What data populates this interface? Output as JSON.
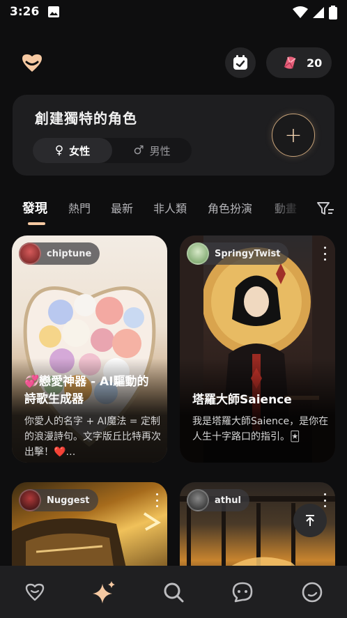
{
  "status_bar": {
    "time": "3:26"
  },
  "header": {
    "gem_count": "20"
  },
  "create_card": {
    "title": "創建獨特的角色",
    "female_label": "女性",
    "male_label": "男性",
    "female_symbol": "♀",
    "male_symbol": "♂",
    "plus_symbol": "+"
  },
  "tabs": [
    {
      "label": "發現",
      "active": true
    },
    {
      "label": "熱門"
    },
    {
      "label": "最新"
    },
    {
      "label": "非人類"
    },
    {
      "label": "角色扮演"
    },
    {
      "label": "動畫"
    }
  ],
  "cards": [
    {
      "author": "chiptune",
      "title": "💞戀愛神器 - AI驅動的詩歌生成器",
      "description": "你愛人的名字 + AI魔法 = 定制的浪漫詩句。文字版丘比特再次出擊！❤️…"
    },
    {
      "author": "SpringyTwist",
      "title": "塔羅大師Saience",
      "description": "我是塔羅大師Saience，是你在人生十字路口的指引。🃏"
    },
    {
      "author": "Nuggest"
    },
    {
      "author": "athul"
    }
  ],
  "colors": {
    "accent": "#f6c9a2",
    "background": "#0e0e0f",
    "card_surface": "#1e1e20"
  }
}
